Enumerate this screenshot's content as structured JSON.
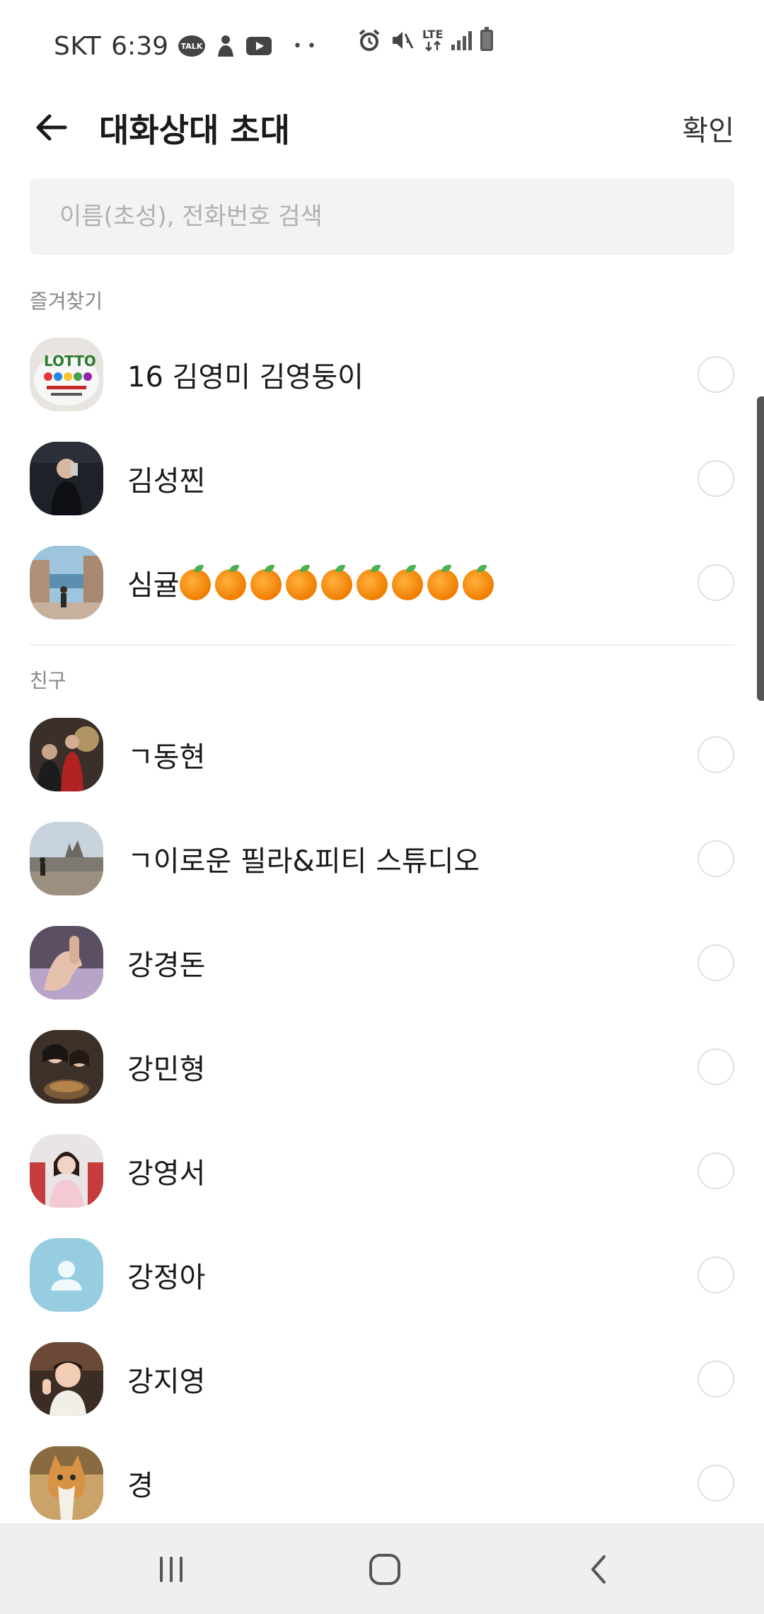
{
  "status_bar": {
    "carrier": "SKT",
    "time": "6:39",
    "talk_badge": "TALK",
    "dots": "• •",
    "lte_label": "LTE",
    "icons": [
      "talk-icon",
      "person-notification-icon",
      "youtube-icon",
      "alarm-icon",
      "mute-icon",
      "lte-icon",
      "signal-icon",
      "battery-icon"
    ]
  },
  "header": {
    "title": "대화상대 초대",
    "confirm_label": "확인"
  },
  "search": {
    "placeholder": "이름(초성), 전화번호 검색",
    "value": ""
  },
  "sections": {
    "favorites_label": "즐겨찾기",
    "friends_label": "친구"
  },
  "favorites": [
    {
      "name": "16 김영미 김영둥이",
      "avatar": "lotto-cake-photo",
      "selected": false
    },
    {
      "name": "김성찐",
      "avatar": "mirror-selfie-photo",
      "selected": false
    },
    {
      "name": "심귤",
      "emoji_suffix_count": 9,
      "avatar": "travel-street-photo",
      "selected": false
    }
  ],
  "friends": [
    {
      "name": "ㄱ동현",
      "avatar": "group-photo",
      "selected": false
    },
    {
      "name": "ㄱ이로운 필라&피티 스튜디오",
      "avatar": "landscape-castle-photo",
      "selected": false
    },
    {
      "name": "강경돈",
      "avatar": "hand-photo",
      "selected": false
    },
    {
      "name": "강민형",
      "avatar": "two-people-photo",
      "selected": false
    },
    {
      "name": "강영서",
      "avatar": "girl-portrait-photo",
      "selected": false
    },
    {
      "name": "강정아",
      "avatar": "default-person-icon",
      "selected": false
    },
    {
      "name": "강지영",
      "avatar": "child-photo",
      "selected": false
    },
    {
      "name": "경",
      "avatar": "cat-photo",
      "selected": false
    }
  ],
  "colors": {
    "search_bg": "#f3f3f3",
    "nav_bg": "#efefef",
    "default_avatar": "#96cde0"
  }
}
